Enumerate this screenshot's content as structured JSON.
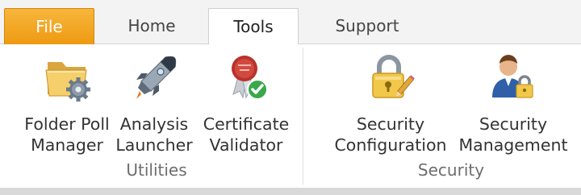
{
  "tabs": {
    "file": "File",
    "home": "Home",
    "tools": "Tools",
    "support": "Support"
  },
  "active_tab": "Tools",
  "groups": {
    "utilities": {
      "label": "Utilities",
      "buttons": [
        {
          "line1": "Folder Poll",
          "line2": "Manager",
          "icon": "folder-gear-icon"
        },
        {
          "line1": "Analysis",
          "line2": "Launcher",
          "icon": "rocket-icon"
        },
        {
          "line1": "Certificate",
          "line2": "Validator",
          "icon": "certificate-check-icon"
        }
      ]
    },
    "security": {
      "label": "Security",
      "buttons": [
        {
          "line1": "Security",
          "line2": "Configuration",
          "icon": "padlock-pencil-icon"
        },
        {
          "line1": "Security",
          "line2": "Management",
          "icon": "user-lock-icon"
        }
      ]
    }
  },
  "colors": {
    "file_tab": "#f0a21e",
    "ribbon_bg": "#ffffff",
    "tabstrip_bg": "#f3f3f3"
  }
}
